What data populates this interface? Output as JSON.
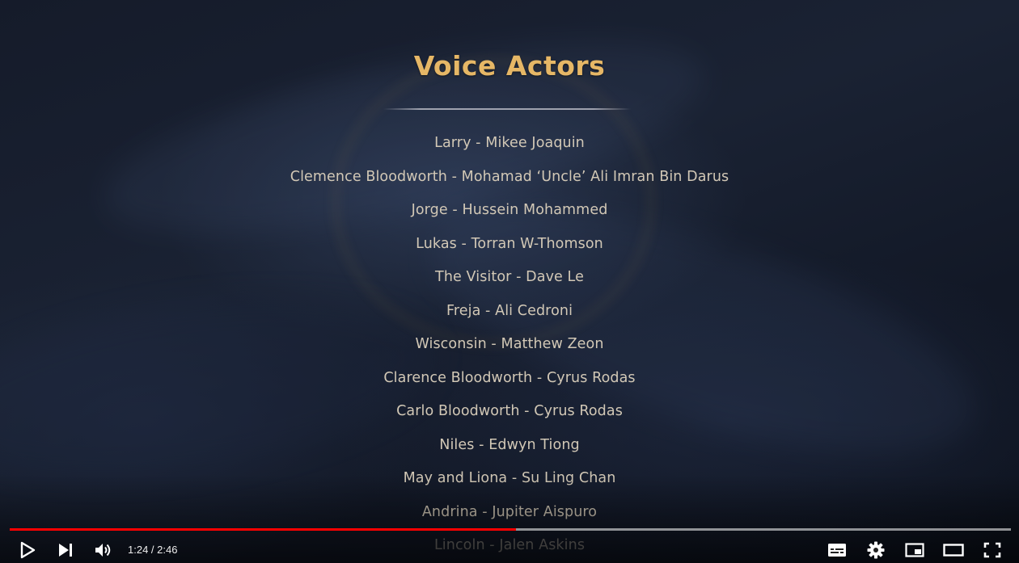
{
  "video": {
    "section_title": "Voice Actors",
    "credits": [
      "Larry - Mikee Joaquin",
      "Clemence Bloodworth - Mohamad ‘Uncle’ Ali Imran Bin Darus",
      "Jorge - Hussein Mohammed",
      "Lukas - Torran W-Thomson",
      "The Visitor - Dave Le",
      "Freja - Ali Cedroni",
      "Wisconsin - Matthew Zeon",
      "Clarence Bloodworth - Cyrus Rodas",
      "Carlo Bloodworth - Cyrus Rodas",
      "Niles - Edwyn Tiong",
      "May and Liona - Su Ling Chan",
      "Andrina - Jupiter Aispuro",
      "Lincoln - Jalen Askins"
    ]
  },
  "player": {
    "time_display": "1:24 / 2:46",
    "progress": {
      "played_fraction": 0.506,
      "loaded_fraction": 1.0,
      "played_color": "#ff0000"
    },
    "controls": {
      "left": [
        "play-icon",
        "next-icon",
        "volume-icon"
      ],
      "right": [
        "subtitles-icon",
        "settings-icon",
        "miniplayer-icon",
        "theater-icon",
        "fullscreen-icon"
      ]
    },
    "colors": {
      "title": "#e6b766",
      "credit_text": "#d2c8b6",
      "icon": "#ffffff"
    }
  }
}
